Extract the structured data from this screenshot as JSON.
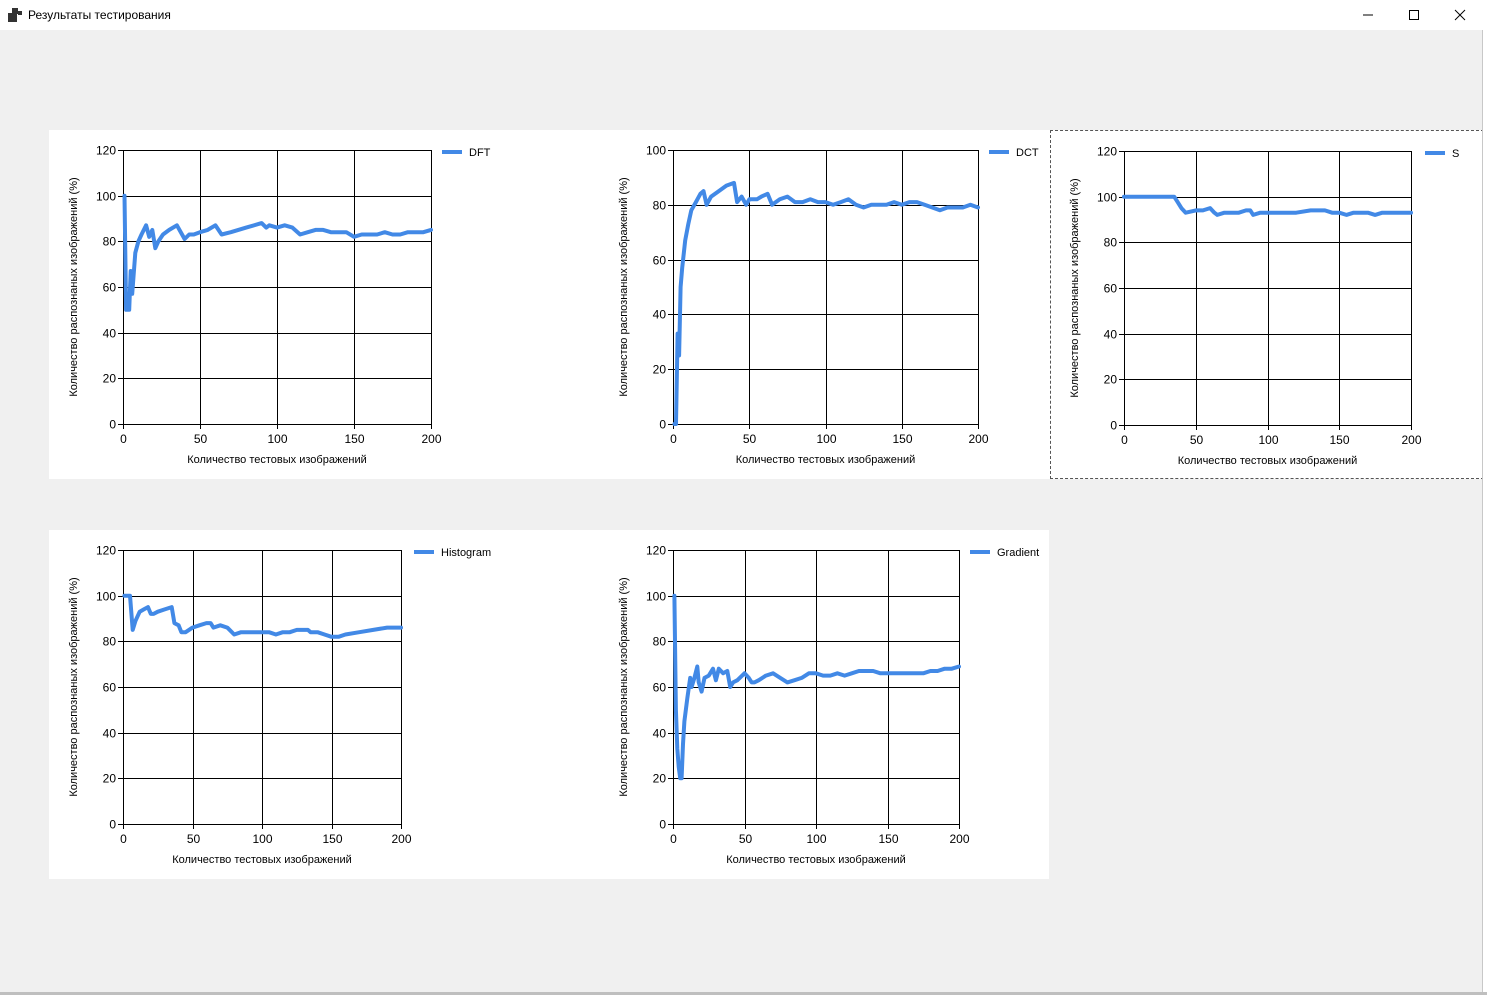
{
  "window": {
    "title": "Результаты тестирования",
    "controls": {
      "minimize": "—",
      "maximize": "☐",
      "close": "✕"
    }
  },
  "colors": {
    "series": "#4289e6",
    "grid": "#000000",
    "panel": "#ffffff",
    "background": "#f0f0f0"
  },
  "chart_data": [
    {
      "type": "line",
      "legend": "DFT",
      "xlabel": "Количество тестовых изображений",
      "ylabel": "Количество распознаных изображений (%)",
      "xlim": [
        0,
        200
      ],
      "ylim": [
        0,
        120
      ],
      "xticks": [
        0,
        50,
        100,
        150,
        200
      ],
      "yticks": [
        0,
        20,
        40,
        60,
        80,
        100,
        120
      ],
      "grid": true,
      "legend_position": "top-right",
      "x": [
        1,
        2,
        3,
        4,
        5,
        6,
        8,
        10,
        12,
        15,
        17,
        19,
        21,
        23,
        26,
        30,
        35,
        40,
        43,
        46,
        50,
        55,
        60,
        64,
        70,
        80,
        90,
        93,
        95,
        100,
        105,
        110,
        115,
        120,
        125,
        130,
        135,
        140,
        145,
        150,
        155,
        160,
        165,
        170,
        175,
        180,
        185,
        190,
        195,
        200
      ],
      "y": [
        100,
        50,
        50,
        50,
        67,
        57,
        75,
        80,
        83,
        87,
        82,
        85,
        77,
        80,
        83,
        85,
        87,
        81,
        83,
        83,
        84,
        85,
        87,
        83,
        84,
        86,
        88,
        86,
        87,
        86,
        87,
        86,
        83,
        84,
        85,
        85,
        84,
        84,
        84,
        82,
        83,
        83,
        83,
        84,
        83,
        83,
        84,
        84,
        84,
        85
      ]
    },
    {
      "type": "line",
      "legend": "DCT",
      "xlabel": "Количество тестовых изображений",
      "ylabel": "Количество распознаных изображений (%)",
      "xlim": [
        0,
        200
      ],
      "ylim": [
        0,
        100
      ],
      "xticks": [
        0,
        50,
        100,
        150,
        200
      ],
      "yticks": [
        0,
        20,
        40,
        60,
        80,
        100
      ],
      "grid": true,
      "legend_position": "top-right",
      "x": [
        1,
        2,
        3,
        4,
        5,
        6,
        8,
        10,
        12,
        15,
        18,
        20,
        22,
        25,
        30,
        35,
        40,
        42,
        45,
        48,
        50,
        55,
        58,
        62,
        65,
        70,
        75,
        80,
        85,
        90,
        95,
        100,
        105,
        110,
        115,
        120,
        125,
        130,
        135,
        140,
        145,
        150,
        155,
        160,
        165,
        170,
        175,
        180,
        185,
        190,
        195,
        200
      ],
      "y": [
        0,
        0,
        33,
        25,
        50,
        57,
        67,
        73,
        78,
        81,
        84,
        85,
        80,
        83,
        85,
        87,
        88,
        81,
        83,
        80,
        82,
        82,
        83,
        84,
        80,
        82,
        83,
        81,
        81,
        82,
        81,
        81,
        80,
        81,
        82,
        80,
        79,
        80,
        80,
        80,
        81,
        80,
        81,
        81,
        80,
        79,
        78,
        79,
        79,
        79,
        80,
        79
      ]
    },
    {
      "type": "line",
      "legend": "S",
      "xlabel": "Количество тестовых изображений",
      "ylabel": "Количество распознаных изображений (%)",
      "xlim": [
        0,
        200
      ],
      "ylim": [
        0,
        120
      ],
      "xticks": [
        0,
        50,
        100,
        150,
        200
      ],
      "yticks": [
        0,
        20,
        40,
        60,
        80,
        100,
        120
      ],
      "grid": true,
      "legend_position": "top-right",
      "x": [
        0,
        5,
        10,
        20,
        30,
        35,
        37,
        40,
        43,
        50,
        55,
        60,
        63,
        65,
        70,
        80,
        85,
        88,
        90,
        95,
        100,
        105,
        110,
        115,
        120,
        130,
        140,
        145,
        150,
        155,
        160,
        165,
        170,
        175,
        180,
        190,
        200
      ],
      "y": [
        100,
        100,
        100,
        100,
        100,
        100,
        98,
        95,
        93,
        94,
        94,
        95,
        93,
        92,
        93,
        93,
        94,
        94,
        92,
        93,
        93,
        93,
        93,
        93,
        93,
        94,
        94,
        93,
        93,
        92,
        93,
        93,
        93,
        92,
        93,
        93,
        93
      ]
    },
    {
      "type": "line",
      "legend": "Histogram",
      "xlabel": "Количество тестовых изображений",
      "ylabel": "Количество распознаных изображений (%)",
      "xlim": [
        0,
        200
      ],
      "ylim": [
        0,
        120
      ],
      "xticks": [
        0,
        50,
        100,
        150,
        200
      ],
      "yticks": [
        0,
        20,
        40,
        60,
        80,
        100,
        120
      ],
      "grid": true,
      "legend_position": "top-right",
      "x": [
        1,
        3,
        5,
        7,
        9,
        12,
        15,
        18,
        20,
        22,
        25,
        30,
        35,
        37,
        40,
        42,
        45,
        50,
        55,
        60,
        63,
        65,
        70,
        75,
        80,
        85,
        90,
        95,
        100,
        105,
        110,
        115,
        120,
        125,
        130,
        133,
        135,
        140,
        145,
        150,
        155,
        160,
        170,
        180,
        190,
        200
      ],
      "y": [
        100,
        100,
        100,
        85,
        89,
        93,
        94,
        95,
        92,
        92,
        93,
        94,
        95,
        88,
        87,
        84,
        84,
        86,
        87,
        88,
        88,
        86,
        87,
        86,
        83,
        84,
        84,
        84,
        84,
        84,
        83,
        84,
        84,
        85,
        85,
        85,
        84,
        84,
        83,
        82,
        82,
        83,
        84,
        85,
        86,
        86
      ]
    },
    {
      "type": "line",
      "legend": "Gradient",
      "xlabel": "Количество тестовых изображений",
      "ylabel": "Количество распознаных изображений (%)",
      "xlim": [
        0,
        200
      ],
      "ylim": [
        0,
        120
      ],
      "xticks": [
        0,
        50,
        100,
        150,
        200
      ],
      "yticks": [
        0,
        20,
        40,
        60,
        80,
        100,
        120
      ],
      "grid": true,
      "legend_position": "top-right",
      "x": [
        1,
        2,
        3,
        4,
        5,
        6,
        7,
        8,
        10,
        12,
        13,
        15,
        17,
        18,
        20,
        22,
        25,
        28,
        30,
        32,
        35,
        38,
        40,
        42,
        45,
        50,
        53,
        55,
        57,
        60,
        65,
        70,
        75,
        80,
        85,
        90,
        95,
        100,
        105,
        110,
        115,
        120,
        125,
        130,
        135,
        140,
        145,
        150,
        155,
        160,
        165,
        170,
        175,
        180,
        185,
        190,
        195,
        200
      ],
      "y": [
        100,
        50,
        33,
        25,
        20,
        20,
        35,
        45,
        55,
        64,
        60,
        64,
        69,
        62,
        58,
        64,
        65,
        68,
        63,
        68,
        66,
        67,
        60,
        62,
        63,
        66,
        64,
        62,
        62,
        63,
        65,
        66,
        64,
        62,
        63,
        64,
        66,
        66,
        65,
        65,
        66,
        65,
        66,
        67,
        67,
        67,
        66,
        66,
        66,
        66,
        66,
        66,
        66,
        67,
        67,
        68,
        68,
        69
      ]
    }
  ]
}
